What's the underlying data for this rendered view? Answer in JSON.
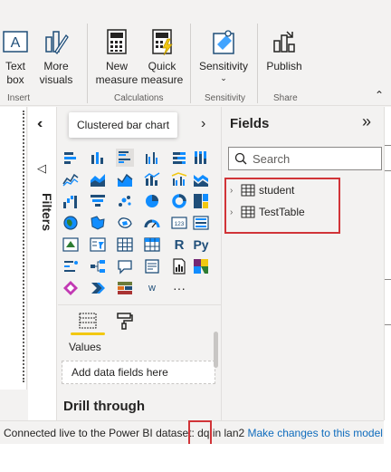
{
  "ribbon": {
    "text_box": "Text\nbox",
    "more_visuals": "More\nvisuals",
    "new_measure": "New\nmeasure",
    "quick_measure": "Quick\nmeasure",
    "sensitivity": "Sensitivity",
    "publish": "Publish",
    "groups": {
      "insert": "Insert",
      "calculations": "Calculations",
      "sensitivity": "Sensitivity",
      "share": "Share"
    }
  },
  "filters": {
    "label": "Filters"
  },
  "visualizations": {
    "tooltip": "Clustered bar chart",
    "values_label": "Values",
    "dropzone": "Add data fields here",
    "drill_through": "Drill through",
    "more": "···",
    "r_label": "R",
    "py_label": "Py",
    "w_label": "w",
    "num_label": "123"
  },
  "fields": {
    "title": "Fields",
    "search_placeholder": "Search",
    "tables": [
      {
        "name": "student"
      },
      {
        "name": "TestTable"
      }
    ]
  },
  "status": {
    "prefix": "Connected live to the Power BI dataset: ",
    "dataset": "dq",
    "mid": " in lan2 ",
    "link": "Make changes to this model"
  },
  "colors": {
    "accent_yellow": "#f2c811",
    "highlight_red": "#d13438",
    "link_blue": "#0f6cbd",
    "viz_blue": "#1f4e79",
    "viz_teal": "#118dff"
  }
}
